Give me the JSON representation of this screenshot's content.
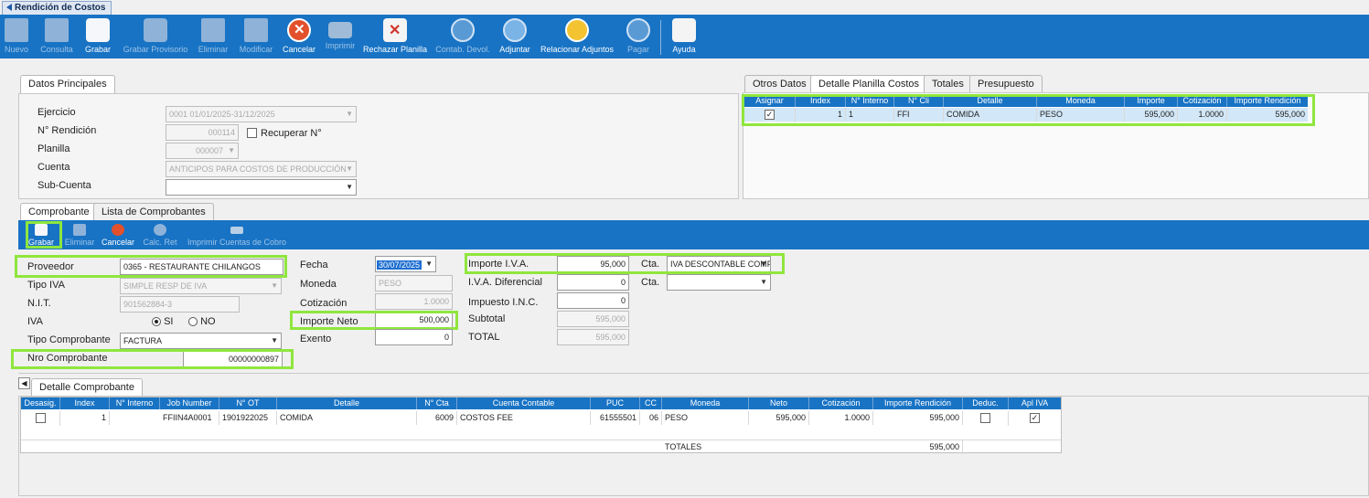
{
  "window": {
    "title": "Rendición de Costos"
  },
  "toolbar": [
    {
      "label": "Nuevo",
      "icon": "new-doc-icon",
      "enabled": false
    },
    {
      "label": "Consulta",
      "icon": "query-icon",
      "enabled": false
    },
    {
      "label": "Grabar",
      "icon": "save-icon",
      "enabled": true
    },
    {
      "label": "Grabar Provisorio",
      "icon": "save-draft-icon",
      "enabled": false
    },
    {
      "label": "Eliminar",
      "icon": "delete-icon",
      "enabled": false
    },
    {
      "label": "Modificar",
      "icon": "edit-icon",
      "enabled": false
    },
    {
      "label": "Cancelar",
      "icon": "cancel-icon",
      "enabled": true
    },
    {
      "label": "Imprimir",
      "icon": "print-icon",
      "enabled": false
    },
    {
      "label": "Rechazar Planilla",
      "icon": "reject-icon",
      "enabled": true
    },
    {
      "label": "Contab. Devol.",
      "icon": "accounting-icon",
      "enabled": false
    },
    {
      "label": "Adjuntar",
      "icon": "attach-icon",
      "enabled": true
    },
    {
      "label": "Relacionar Adjuntos",
      "icon": "link-attachments-icon",
      "enabled": true
    },
    {
      "label": "Pagar",
      "icon": "pay-icon",
      "enabled": false
    },
    {
      "label": "Ayuda",
      "icon": "help-icon",
      "enabled": true
    }
  ],
  "datos_principales": {
    "tab": "Datos Principales",
    "ejercicio_label": "Ejercicio",
    "ejercicio_value": "0001 01/01/2025-31/12/2025",
    "rendicion_label": "N° Rendición",
    "rendicion_value": "000114",
    "recuperar_label": "Recuperar N°",
    "planilla_label": "Planilla",
    "planilla_value": "000007",
    "cuenta_label": "Cuenta",
    "cuenta_value": "ANTICIPOS PARA COSTOS DE PRODUCCIÓN",
    "subcuenta_label": "Sub-Cuenta",
    "subcuenta_value": ""
  },
  "right_tabs": [
    "Otros Datos",
    "Detalle Planilla Costos",
    "Totales",
    "Presupuesto"
  ],
  "planilla_grid": {
    "headers": [
      "Asignar",
      "Index",
      "N° Interno",
      "N° Cli",
      "Detalle",
      "Moneda",
      "Importe",
      "Cotización",
      "Importe Rendición"
    ],
    "row": {
      "asignar": "✓",
      "index": "1",
      "interno": "1",
      "cli": "FFI",
      "detalle": "COMIDA",
      "moneda": "PESO",
      "importe": "595,000",
      "cotizacion": "1.0000",
      "importe_rendicion": "595,000"
    }
  },
  "comprobante_tabs": [
    "Comprobante",
    "Lista de Comprobantes"
  ],
  "subtoolbar": [
    {
      "label": "Grabar",
      "icon": "save-icon",
      "enabled": true
    },
    {
      "label": "Eliminar",
      "icon": "delete-icon",
      "enabled": false
    },
    {
      "label": "Cancelar",
      "icon": "cancel-icon",
      "enabled": true
    },
    {
      "label": "Calc. Ret",
      "icon": "calc-icon",
      "enabled": false
    },
    {
      "label": "Imprimir Cuentas de Cobro",
      "icon": "print-icon",
      "enabled": false
    }
  ],
  "comprobante": {
    "proveedor_label": "Proveedor",
    "proveedor_value": "0365 - RESTAURANTE CHILANGOS",
    "tipo_iva_label": "Tipo IVA",
    "tipo_iva_value": "SIMPLE RESP DE IVA",
    "nit_label": "N.I.T.",
    "nit_value": "901562884-3",
    "iva_label": "IVA",
    "iva_si": "SI",
    "iva_no": "NO",
    "tipo_comprobante_label": "Tipo Comprobante",
    "tipo_comprobante_value": "FACTURA",
    "nro_comprobante_label": "Nro Comprobante",
    "nro_comprobante_value": "00000000897",
    "fecha_label": "Fecha",
    "fecha_value": "30/07/2025",
    "moneda_label": "Moneda",
    "moneda_value": "PESO",
    "cotizacion_label": "Cotización",
    "cotizacion_value": "1.0000",
    "importe_neto_label": "Importe Neto",
    "importe_neto_value": "500,000",
    "exento_label": "Exento",
    "exento_value": "0",
    "importe_iva_label": "Importe I.V.A.",
    "importe_iva_value": "95,000",
    "cta_label": "Cta.",
    "cta_value": "IVA DESCONTABLE COMP",
    "iva_dif_label": "I.V.A. Diferencial",
    "iva_dif_value": "0",
    "cta2_label": "Cta.",
    "cta2_value": "",
    "impuesto_inc_label": "Impuesto I.N.C.",
    "impuesto_inc_value": "0",
    "subtotal_label": "Subtotal",
    "subtotal_value": "595,000",
    "total_label": "TOTAL",
    "total_value": "595,000"
  },
  "detalle_tab": "Detalle Comprobante",
  "detalle_grid": {
    "headers": [
      "Desasig.",
      "Index",
      "N° Interno",
      "Job Number",
      "N° OT",
      "Detalle",
      "N° Cta",
      "Cuenta Contable",
      "PUC",
      "CC",
      "Moneda",
      "Neto",
      "Cotización",
      "Importe Rendición",
      "Deduc.",
      "Apl IVA"
    ],
    "row": {
      "index": "1",
      "interno": "",
      "job": "FFIIN4A0001",
      "ot": "1901922025",
      "detalle": "COMIDA",
      "cta": "6009",
      "cuenta": "COSTOS FEE",
      "puc": "61555501",
      "cc": "06",
      "moneda": "PESO",
      "neto": "595,000",
      "cotizacion": "1.0000",
      "importe_rendicion": "595,000",
      "apl_iva": "✓"
    },
    "totales_label": "TOTALES",
    "totales_value": "595,000"
  }
}
